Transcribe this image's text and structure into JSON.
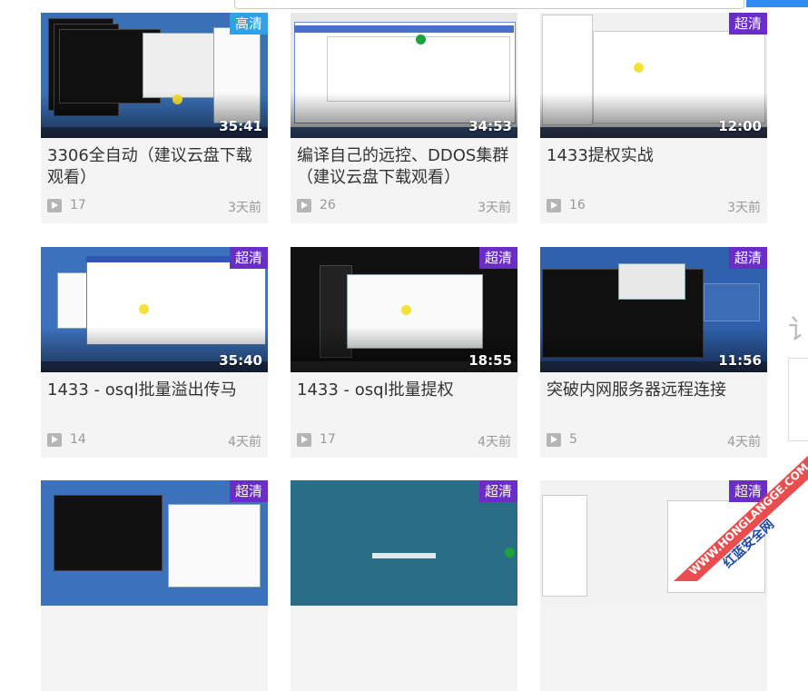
{
  "page": {
    "side_glyph": "讠"
  },
  "cards": [
    {
      "title": "3306全自动（建议云盘下载观看）",
      "views": "17",
      "ago": "3天前",
      "duration": "35:41",
      "badge": "高清",
      "badge_color": "#32a0e6"
    },
    {
      "title": "编译自己的远控、DDOS集群（建议云盘下载观看）",
      "views": "26",
      "ago": "3天前",
      "duration": "34:53",
      "badge": "",
      "badge_color": ""
    },
    {
      "title": "1433提权实战",
      "views": "16",
      "ago": "3天前",
      "duration": "12:00",
      "badge": "超清",
      "badge_color": "#6a2ec7"
    },
    {
      "title": "1433 - osql批量溢出传马",
      "views": "14",
      "ago": "4天前",
      "duration": "35:40",
      "badge": "超清",
      "badge_color": "#6a2ec7"
    },
    {
      "title": "1433 - osql批量提权",
      "views": "17",
      "ago": "4天前",
      "duration": "18:55",
      "badge": "超清",
      "badge_color": "#6a2ec7"
    },
    {
      "title": "突破内网服务器远程连接",
      "views": "5",
      "ago": "4天前",
      "duration": "11:56",
      "badge": "超清",
      "badge_color": "#6a2ec7"
    },
    {
      "title": "",
      "views": "",
      "ago": "",
      "duration": "",
      "badge": "超清",
      "badge_color": "#6a2ec7"
    },
    {
      "title": "",
      "views": "",
      "ago": "",
      "duration": "",
      "badge": "超清",
      "badge_color": "#6a2ec7"
    },
    {
      "title": "",
      "views": "",
      "ago": "",
      "duration": "",
      "badge": "超清",
      "badge_color": "#6a2ec7"
    }
  ],
  "watermark": {
    "line1": "WWW.HONGLANGGE.COM",
    "line2": "红蓝安全网"
  }
}
